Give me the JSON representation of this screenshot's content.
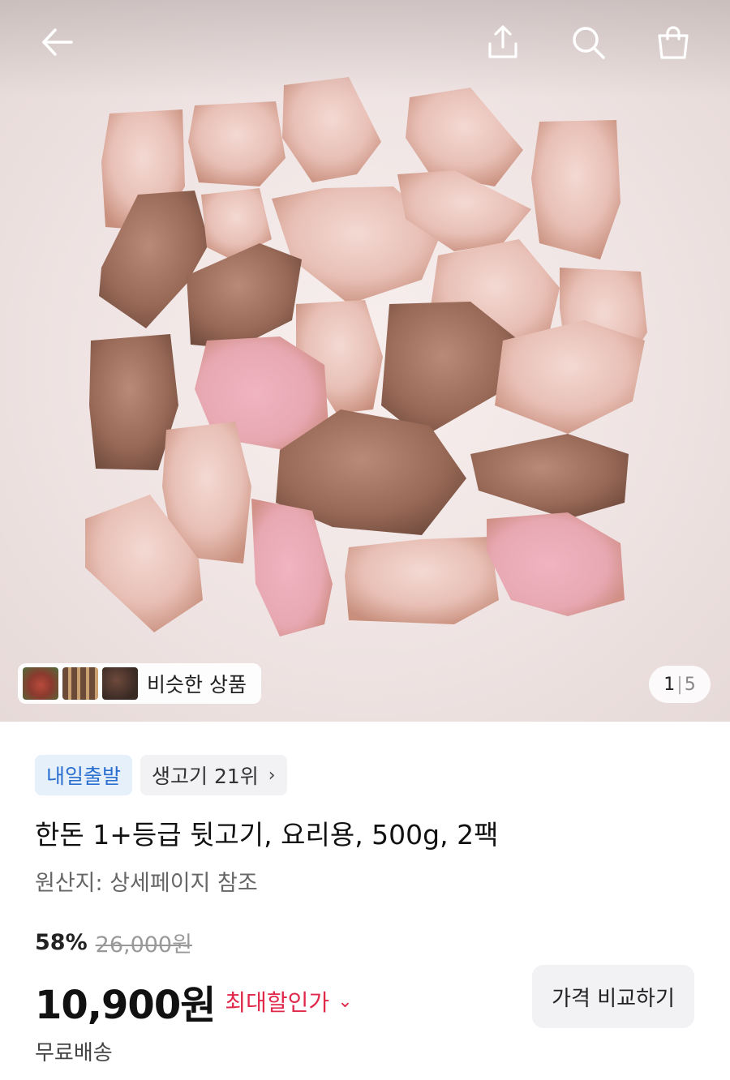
{
  "header": {
    "back_icon": "arrow-left-icon",
    "share_icon": "share-icon",
    "search_icon": "search-icon",
    "cart_icon": "shopping-bag-icon"
  },
  "gallery": {
    "similar_label": "비슷한 상품",
    "current_page": "1",
    "total_pages": "5"
  },
  "badges": {
    "delivery": "내일출발",
    "ranking": "생고기 21위"
  },
  "product": {
    "title": "한돈 1+등급 뒷고기, 요리용, 500g, 2팩",
    "origin": "원산지: 상세페이지 참조",
    "discount_percent": "58%",
    "original_price": "26,000원",
    "price": "10,900원",
    "max_discount_label": "최대할인가",
    "compare_button": "가격 비교하기",
    "shipping": "무료배송"
  },
  "colors": {
    "accent_red": "#e0284a",
    "badge_blue": "#2a6fd0"
  }
}
